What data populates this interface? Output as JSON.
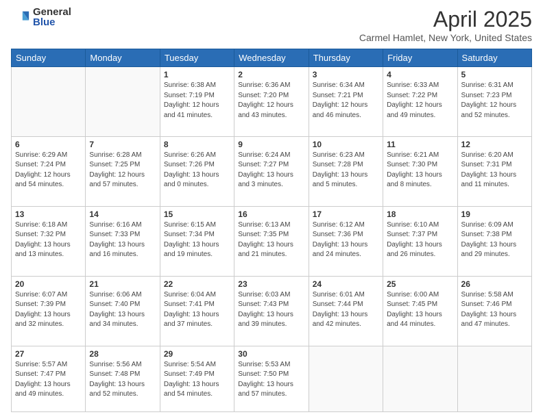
{
  "logo": {
    "general": "General",
    "blue": "Blue"
  },
  "title": "April 2025",
  "location": "Carmel Hamlet, New York, United States",
  "days_of_week": [
    "Sunday",
    "Monday",
    "Tuesday",
    "Wednesday",
    "Thursday",
    "Friday",
    "Saturday"
  ],
  "weeks": [
    [
      {
        "day": "",
        "info": ""
      },
      {
        "day": "",
        "info": ""
      },
      {
        "day": "1",
        "info": "Sunrise: 6:38 AM\nSunset: 7:19 PM\nDaylight: 12 hours\nand 41 minutes."
      },
      {
        "day": "2",
        "info": "Sunrise: 6:36 AM\nSunset: 7:20 PM\nDaylight: 12 hours\nand 43 minutes."
      },
      {
        "day": "3",
        "info": "Sunrise: 6:34 AM\nSunset: 7:21 PM\nDaylight: 12 hours\nand 46 minutes."
      },
      {
        "day": "4",
        "info": "Sunrise: 6:33 AM\nSunset: 7:22 PM\nDaylight: 12 hours\nand 49 minutes."
      },
      {
        "day": "5",
        "info": "Sunrise: 6:31 AM\nSunset: 7:23 PM\nDaylight: 12 hours\nand 52 minutes."
      }
    ],
    [
      {
        "day": "6",
        "info": "Sunrise: 6:29 AM\nSunset: 7:24 PM\nDaylight: 12 hours\nand 54 minutes."
      },
      {
        "day": "7",
        "info": "Sunrise: 6:28 AM\nSunset: 7:25 PM\nDaylight: 12 hours\nand 57 minutes."
      },
      {
        "day": "8",
        "info": "Sunrise: 6:26 AM\nSunset: 7:26 PM\nDaylight: 13 hours\nand 0 minutes."
      },
      {
        "day": "9",
        "info": "Sunrise: 6:24 AM\nSunset: 7:27 PM\nDaylight: 13 hours\nand 3 minutes."
      },
      {
        "day": "10",
        "info": "Sunrise: 6:23 AM\nSunset: 7:28 PM\nDaylight: 13 hours\nand 5 minutes."
      },
      {
        "day": "11",
        "info": "Sunrise: 6:21 AM\nSunset: 7:30 PM\nDaylight: 13 hours\nand 8 minutes."
      },
      {
        "day": "12",
        "info": "Sunrise: 6:20 AM\nSunset: 7:31 PM\nDaylight: 13 hours\nand 11 minutes."
      }
    ],
    [
      {
        "day": "13",
        "info": "Sunrise: 6:18 AM\nSunset: 7:32 PM\nDaylight: 13 hours\nand 13 minutes."
      },
      {
        "day": "14",
        "info": "Sunrise: 6:16 AM\nSunset: 7:33 PM\nDaylight: 13 hours\nand 16 minutes."
      },
      {
        "day": "15",
        "info": "Sunrise: 6:15 AM\nSunset: 7:34 PM\nDaylight: 13 hours\nand 19 minutes."
      },
      {
        "day": "16",
        "info": "Sunrise: 6:13 AM\nSunset: 7:35 PM\nDaylight: 13 hours\nand 21 minutes."
      },
      {
        "day": "17",
        "info": "Sunrise: 6:12 AM\nSunset: 7:36 PM\nDaylight: 13 hours\nand 24 minutes."
      },
      {
        "day": "18",
        "info": "Sunrise: 6:10 AM\nSunset: 7:37 PM\nDaylight: 13 hours\nand 26 minutes."
      },
      {
        "day": "19",
        "info": "Sunrise: 6:09 AM\nSunset: 7:38 PM\nDaylight: 13 hours\nand 29 minutes."
      }
    ],
    [
      {
        "day": "20",
        "info": "Sunrise: 6:07 AM\nSunset: 7:39 PM\nDaylight: 13 hours\nand 32 minutes."
      },
      {
        "day": "21",
        "info": "Sunrise: 6:06 AM\nSunset: 7:40 PM\nDaylight: 13 hours\nand 34 minutes."
      },
      {
        "day": "22",
        "info": "Sunrise: 6:04 AM\nSunset: 7:41 PM\nDaylight: 13 hours\nand 37 minutes."
      },
      {
        "day": "23",
        "info": "Sunrise: 6:03 AM\nSunset: 7:43 PM\nDaylight: 13 hours\nand 39 minutes."
      },
      {
        "day": "24",
        "info": "Sunrise: 6:01 AM\nSunset: 7:44 PM\nDaylight: 13 hours\nand 42 minutes."
      },
      {
        "day": "25",
        "info": "Sunrise: 6:00 AM\nSunset: 7:45 PM\nDaylight: 13 hours\nand 44 minutes."
      },
      {
        "day": "26",
        "info": "Sunrise: 5:58 AM\nSunset: 7:46 PM\nDaylight: 13 hours\nand 47 minutes."
      }
    ],
    [
      {
        "day": "27",
        "info": "Sunrise: 5:57 AM\nSunset: 7:47 PM\nDaylight: 13 hours\nand 49 minutes."
      },
      {
        "day": "28",
        "info": "Sunrise: 5:56 AM\nSunset: 7:48 PM\nDaylight: 13 hours\nand 52 minutes."
      },
      {
        "day": "29",
        "info": "Sunrise: 5:54 AM\nSunset: 7:49 PM\nDaylight: 13 hours\nand 54 minutes."
      },
      {
        "day": "30",
        "info": "Sunrise: 5:53 AM\nSunset: 7:50 PM\nDaylight: 13 hours\nand 57 minutes."
      },
      {
        "day": "",
        "info": ""
      },
      {
        "day": "",
        "info": ""
      },
      {
        "day": "",
        "info": ""
      }
    ]
  ]
}
